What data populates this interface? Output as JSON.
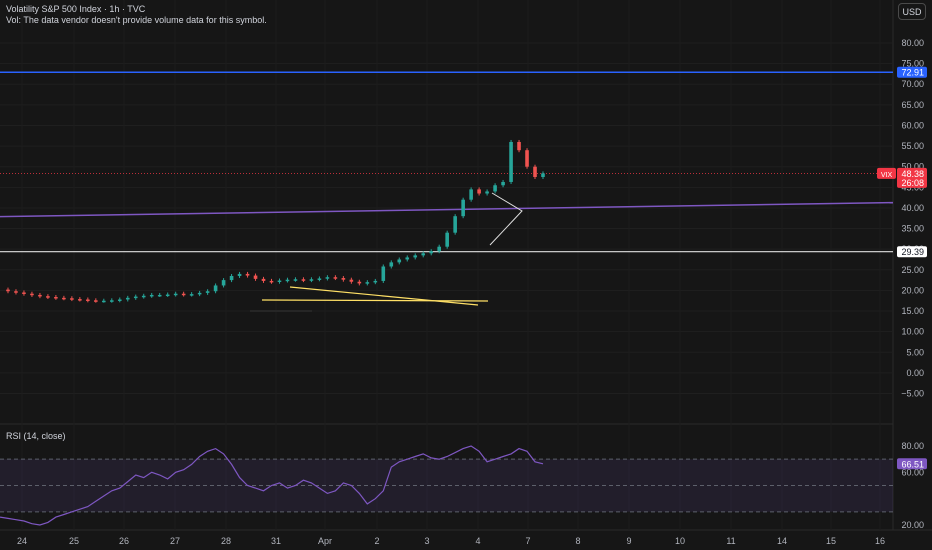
{
  "header": {
    "title": "Volatility S&P 500 Index · 1h · TVC",
    "volume_note": "Vol: The data vendor doesn't provide volume data for this symbol.",
    "currency": "USD"
  },
  "price_axis": {
    "ticks": [
      "80.00",
      "75.00",
      "70.00",
      "65.00",
      "60.00",
      "55.00",
      "50.00",
      "45.00",
      "40.00",
      "35.00",
      "30.00",
      "25.00",
      "20.00",
      "15.00",
      "10.00",
      "5.00",
      "0.00",
      "−5.00"
    ],
    "tick_values": [
      80,
      75,
      70,
      65,
      60,
      55,
      50,
      45,
      40,
      35,
      30,
      25,
      20,
      15,
      10,
      5,
      0,
      -5
    ],
    "labels": [
      {
        "text": "72.91",
        "value": 72.91,
        "color": "#2962ff"
      },
      {
        "text": "48.38",
        "value": 48.38,
        "color": "#f23645",
        "tag": "VIX",
        "subtext": "26:08"
      },
      {
        "text": "29.39",
        "value": 29.39,
        "color": "#ffffff"
      }
    ]
  },
  "time_axis": {
    "labels": [
      "24",
      "25",
      "26",
      "27",
      "28",
      "31",
      "Apr",
      "2",
      "3",
      "4",
      "7",
      "8",
      "9",
      "10",
      "11",
      "14",
      "15",
      "16"
    ]
  },
  "rsi": {
    "label": "RSI (14, close)",
    "ticks": [
      "80.00",
      "60.00",
      "20.00"
    ],
    "tick_values": [
      80,
      60,
      20
    ],
    "current": "66.51",
    "upper_band": 70,
    "lower_band": 30,
    "mid": 50
  },
  "chart_data": {
    "type": "line",
    "symbol": "VIX",
    "lines": {
      "blue_horizontal": 72.91,
      "white_horizontal": 29.39,
      "purple_trend": [
        37.9,
        41.3
      ],
      "red_dotted_price": 48.38
    },
    "price_path": [
      20.2,
      19.8,
      19.5,
      19.2,
      18.9,
      18.6,
      18.4,
      18.2,
      18.1,
      17.9,
      17.8,
      17.6,
      17.5,
      17.5,
      17.6,
      17.8,
      18.2,
      18.5,
      18.7,
      18.9,
      18.9,
      19.0,
      19.2,
      19.0,
      19.1,
      19.4,
      19.8,
      21.2,
      22.5,
      23.5,
      24.0,
      23.6,
      22.8,
      22.3,
      22.1,
      22.4,
      22.6,
      22.7,
      22.5,
      22.7,
      22.9,
      23.2,
      23.0,
      22.6,
      22.1,
      21.7,
      22.0,
      22.3,
      25.8,
      26.8,
      27.5,
      28.0,
      28.5,
      29.0,
      29.5,
      30.6,
      34.0,
      38.0,
      42.0,
      44.5,
      43.5,
      44.0,
      45.5,
      46.3,
      56.0,
      54.0,
      50.0,
      47.5,
      48.38
    ],
    "rsi_values": [
      26,
      25,
      24,
      23,
      21,
      20,
      22,
      26,
      28,
      30,
      32,
      34,
      38,
      42,
      46,
      48,
      53,
      58,
      56,
      60,
      58,
      55,
      60,
      62,
      66,
      72,
      76,
      78,
      74,
      66,
      56,
      50,
      48,
      46,
      50,
      52,
      48,
      50,
      54,
      52,
      48,
      44,
      46,
      52,
      50,
      44,
      36,
      40,
      46,
      64,
      68,
      70,
      72,
      74,
      71,
      70,
      72,
      75,
      78,
      80,
      76,
      68,
      70,
      72,
      74,
      78,
      76,
      68,
      66.51
    ]
  }
}
